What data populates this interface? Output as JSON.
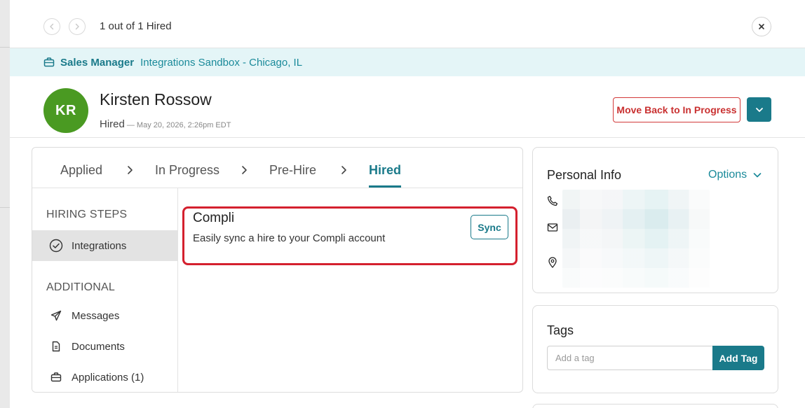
{
  "nav": {
    "counter": "1 out of 1 Hired",
    "prev_icon": "chevron-left-icon",
    "next_icon": "chevron-right-icon",
    "close_icon": "close-icon"
  },
  "job": {
    "title": "Sales Manager",
    "location": "Integrations Sandbox - Chicago, IL",
    "icon": "briefcase-icon"
  },
  "candidate": {
    "initials": "KR",
    "name": "Kirsten Rossow",
    "status": "Hired",
    "date": "— May 20, 2026, 2:26pm EDT",
    "avatar_color": "#4a9a22"
  },
  "actions": {
    "move_back_label": "Move Back to In Progress",
    "dropdown_icon": "chevron-down-icon"
  },
  "stages": [
    {
      "label": "Applied",
      "active": false
    },
    {
      "label": "In Progress",
      "active": false
    },
    {
      "label": "Pre-Hire",
      "active": false
    },
    {
      "label": "Hired",
      "active": true
    }
  ],
  "sidebar": {
    "hiring_steps_heading": "HIRING STEPS",
    "hiring_steps": [
      {
        "label": "Integrations",
        "icon": "check-circle-icon",
        "active": true
      }
    ],
    "additional_heading": "ADDITIONAL",
    "additional": [
      {
        "label": "Messages",
        "icon": "send-icon"
      },
      {
        "label": "Documents",
        "icon": "document-icon"
      },
      {
        "label": "Applications (1)",
        "icon": "briefcase-icon"
      }
    ]
  },
  "integration": {
    "name": "Compli",
    "description": "Easily sync a hire to your Compli account",
    "sync_label": "Sync"
  },
  "personal_info": {
    "title": "Personal Info",
    "options_label": "Options",
    "icons": [
      "phone-icon",
      "mail-icon",
      "location-pin-icon"
    ]
  },
  "tags": {
    "title": "Tags",
    "placeholder": "Add a tag",
    "add_label": "Add Tag"
  },
  "colors": {
    "accent": "#1a7a8a",
    "danger": "#d23a3a",
    "highlight_border": "#d4202e",
    "banner_bg": "#e4f5f7"
  }
}
